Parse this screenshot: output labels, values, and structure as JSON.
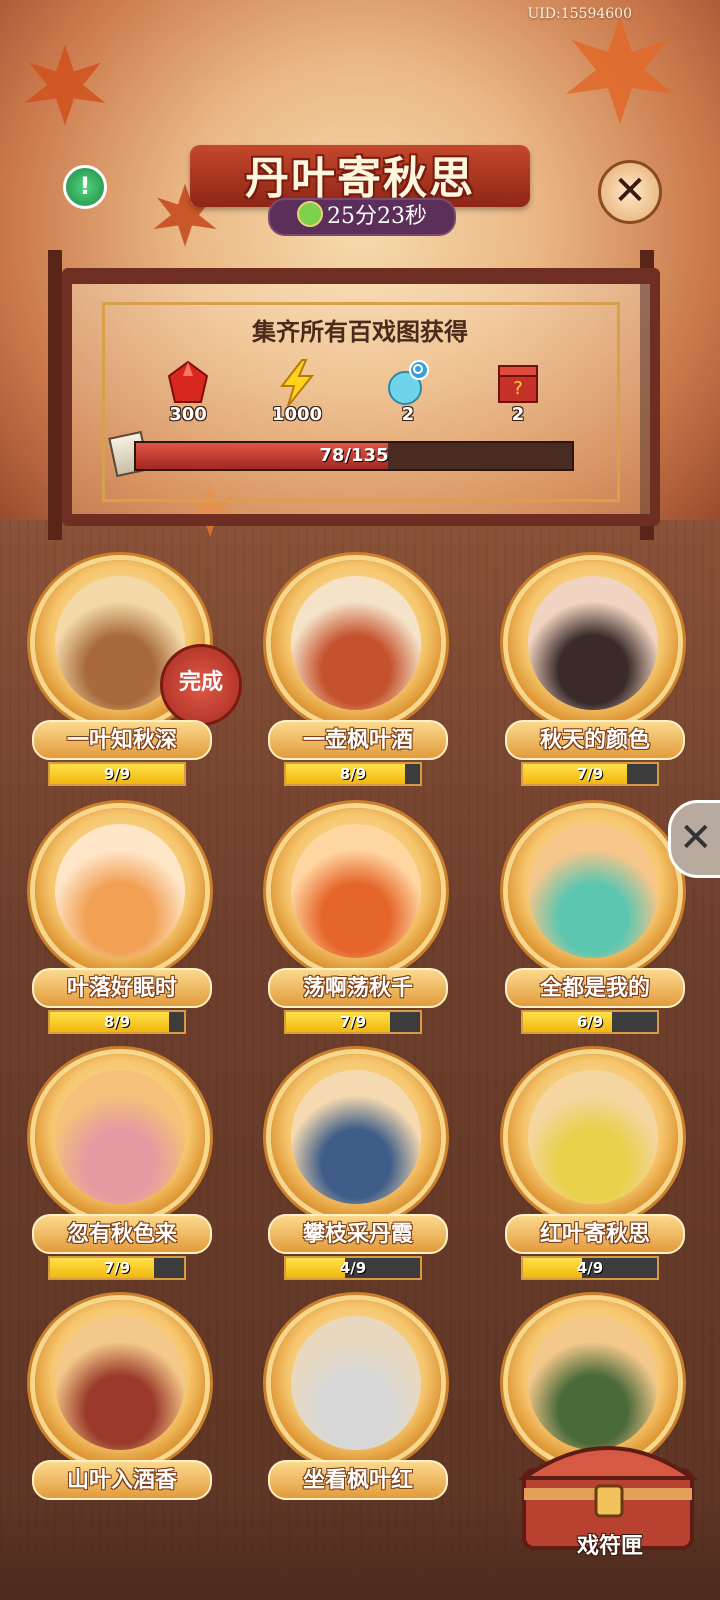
{
  "header": {
    "uid": "UID:15594600",
    "title": "丹叶寄秋思",
    "timer": "25分23秒"
  },
  "collection": {
    "title": "集齐所有百戏图获得",
    "rewards": [
      {
        "icon": "red-gem-icon",
        "count": "300"
      },
      {
        "icon": "lightning-icon",
        "count": "1000"
      },
      {
        "icon": "blue-magnifier-orb-icon",
        "count": "2"
      },
      {
        "icon": "mystery-chest-icon",
        "count": "2"
      }
    ],
    "progress_label": "78/135",
    "progress_value": 0.578
  },
  "cards": [
    {
      "name": "一叶知秋深",
      "progress": "9/9",
      "fraction": 1.0,
      "done_label": "完成",
      "art": "book-scene"
    },
    {
      "name": "一壶枫叶酒",
      "progress": "8/9",
      "fraction": 0.889,
      "art": "teapot"
    },
    {
      "name": "秋天的颜色",
      "progress": "7/9",
      "fraction": 0.778,
      "art": "lady-flowers"
    },
    {
      "name": "叶落好眠时",
      "progress": "8/9",
      "fraction": 0.889,
      "art": "sleeping-cat"
    },
    {
      "name": "荡啊荡秋千",
      "progress": "7/9",
      "fraction": 0.778,
      "art": "swing-cat"
    },
    {
      "name": "全都是我的",
      "progress": "6/9",
      "fraction": 0.667,
      "art": "teal-cat"
    },
    {
      "name": "忽有秋色来",
      "progress": "7/9",
      "fraction": 0.778,
      "art": "pink-lady"
    },
    {
      "name": "攀枝采丹霞",
      "progress": "4/9",
      "fraction": 0.444,
      "art": "straw-hat-man"
    },
    {
      "name": "红叶寄秋思",
      "progress": "4/9",
      "fraction": 0.444,
      "art": "yellow-lady"
    },
    {
      "name": "山叶入酒香",
      "art": "red-lady"
    },
    {
      "name": "坐看枫叶红",
      "art": "white-hair-man"
    },
    {
      "name": "",
      "art": "two-ladies"
    }
  ],
  "chest": {
    "label": "戏符匣"
  },
  "colors": {
    "accent_red": "#b3321f",
    "gold": "#f2b60d",
    "bar_bg": "#3c3c3c"
  }
}
